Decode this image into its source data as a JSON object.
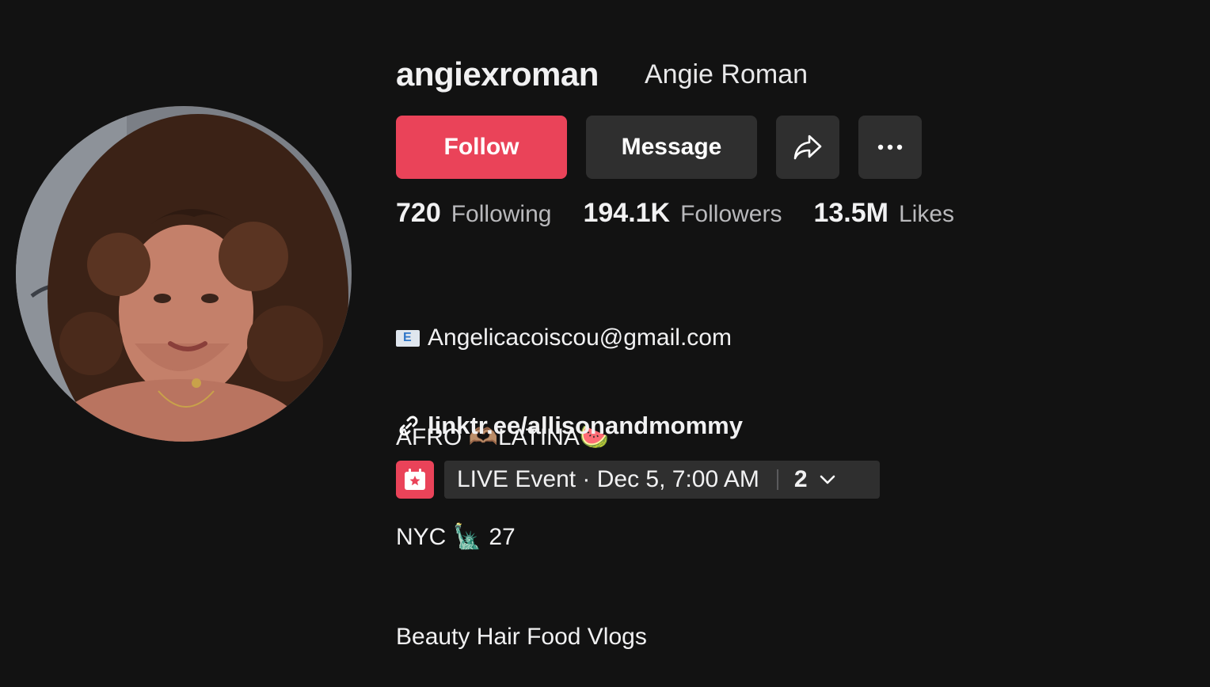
{
  "profile": {
    "username": "angiexroman",
    "display_name": "Angie Roman"
  },
  "actions": {
    "follow_label": "Follow",
    "message_label": "Message",
    "share_icon": "share-icon",
    "more_icon": "more-icon"
  },
  "stats": [
    {
      "value": "720",
      "label": "Following"
    },
    {
      "value": "194.1K",
      "label": "Followers"
    },
    {
      "value": "13.5M",
      "label": "Likes"
    }
  ],
  "bio": {
    "email": "Angelicacoiscou@gmail.com",
    "line2": "AFRO 🫶🏽LATINA🍉",
    "line3": "NYC 🗽 27",
    "line4": "Beauty Hair Food Vlogs"
  },
  "link": {
    "text": "linktr.ee/allisonandmommy",
    "icon": "link-icon"
  },
  "event": {
    "text": "LIVE Event · Dec 5, 7:00 AM",
    "count": "2",
    "icon": "calendar-star-icon"
  },
  "colors": {
    "background": "#121212",
    "accent": "#ea4359",
    "button_secondary": "#2f2f2f",
    "muted_text": "#b9b9bc"
  }
}
